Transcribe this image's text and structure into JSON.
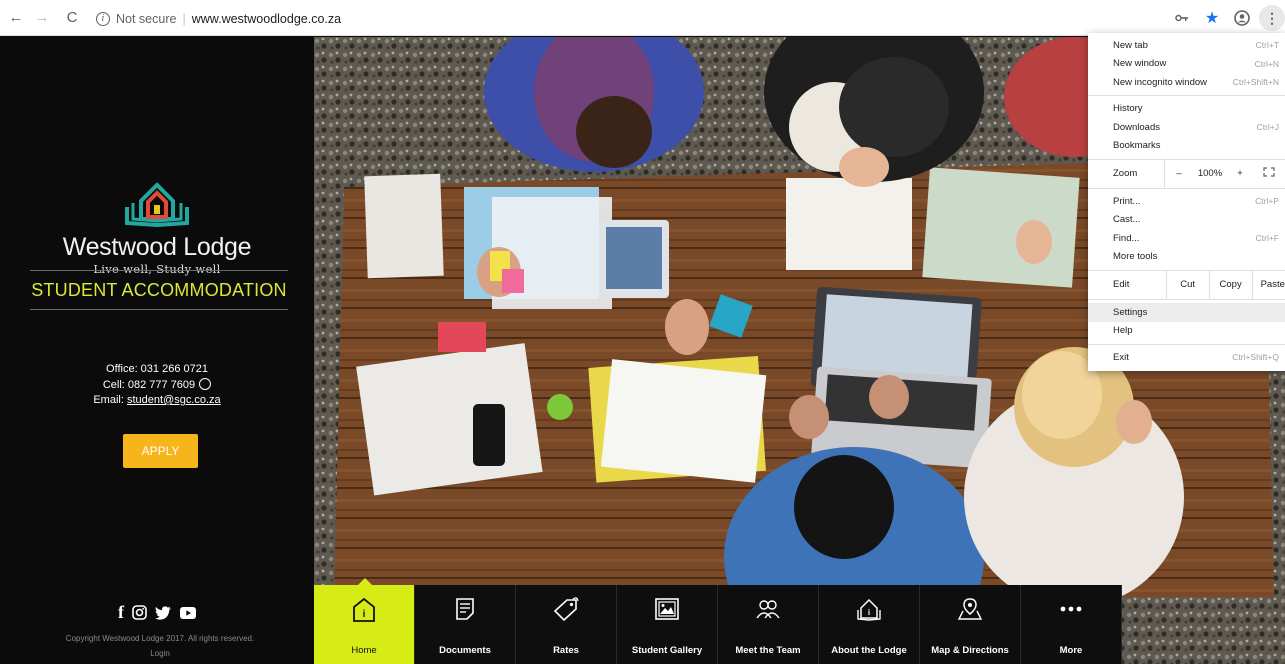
{
  "browser": {
    "security_label": "Not secure",
    "url": "www.westwoodlodge.co.za"
  },
  "sidebar": {
    "logo_name": "Westwood Lodge",
    "logo_tagline": "Live well, Study well",
    "heading": "STUDENT ACCOMMODATION",
    "office": "Office: 031 266 0721",
    "cell": "Cell: 082 777 7609",
    "email_label": "Email: ",
    "email": "student@sgc.co.za",
    "apply_label": "APPLY",
    "copyright": "Copyright Westwood Lodge 2017. All rights reserved.",
    "login": "Login"
  },
  "bottom_nav": [
    {
      "label": "Home",
      "icon": "home-icon"
    },
    {
      "label": "Documents",
      "icon": "document-icon"
    },
    {
      "label": "Rates",
      "icon": "price-tag-icon"
    },
    {
      "label": "Student Gallery",
      "icon": "gallery-icon"
    },
    {
      "label": "Meet the Team",
      "icon": "team-icon"
    },
    {
      "label": "About the Lodge",
      "icon": "lodge-icon"
    },
    {
      "label": "Map & Directions",
      "icon": "map-pin-icon"
    },
    {
      "label": "More",
      "icon": "more-dots-icon"
    }
  ],
  "chrome_menu": {
    "new_tab": "New tab",
    "new_tab_sc": "Ctrl+T",
    "new_window": "New window",
    "new_window_sc": "Ctrl+N",
    "incognito": "New incognito window",
    "incognito_sc": "Ctrl+Shift+N",
    "history": "History",
    "downloads": "Downloads",
    "downloads_sc": "Ctrl+J",
    "bookmarks": "Bookmarks",
    "zoom": "Zoom",
    "zoom_minus": "–",
    "zoom_level": "100%",
    "zoom_plus": "+",
    "print": "Print...",
    "print_sc": "Ctrl+P",
    "cast": "Cast...",
    "find": "Find...",
    "find_sc": "Ctrl+F",
    "more_tools": "More tools",
    "edit": "Edit",
    "cut": "Cut",
    "copy": "Copy",
    "paste": "Paste",
    "settings": "Settings",
    "help": "Help",
    "exit": "Exit",
    "exit_sc": "Ctrl+Shift+Q"
  },
  "colors": {
    "accent_yellow": "#d6ec14",
    "apply_orange": "#f7b51c",
    "logo_teal": "#22a7a0",
    "logo_red": "#e04a3a"
  }
}
